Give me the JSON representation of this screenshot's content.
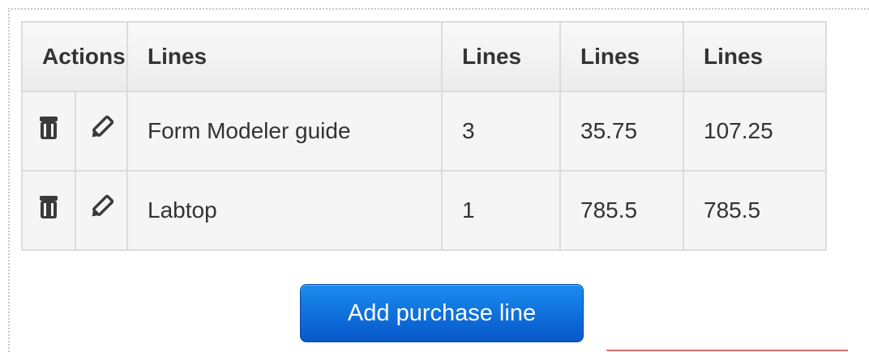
{
  "table": {
    "headers": {
      "actions": "Actions",
      "col1": "Lines",
      "col2": "Lines",
      "col3": "Lines",
      "col4": "Lines"
    },
    "rows": [
      {
        "name": "Form Modeler guide",
        "qty": "3",
        "price": "35.75",
        "total": "107.25"
      },
      {
        "name": "Labtop",
        "qty": "1",
        "price": "785.5",
        "total": "785.5"
      }
    ]
  },
  "add_button_label": "Add purchase line",
  "icons": {
    "delete": "trash-icon",
    "edit": "pencil-icon"
  },
  "colors": {
    "button_top": "#1a8cf0",
    "button_bottom": "#0757c9",
    "header_bg": "#ececec",
    "row_bg": "#f5f5f5"
  }
}
